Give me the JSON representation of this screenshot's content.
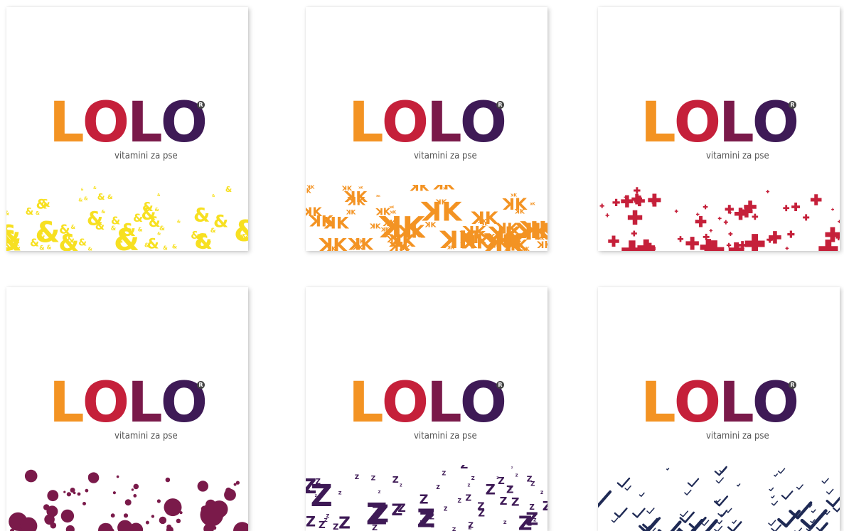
{
  "brand": {
    "letters": [
      "L",
      "O",
      "L",
      "O"
    ],
    "letter_colors": [
      "#f39323",
      "#c5203a",
      "#7a1a4a",
      "#3e1a56"
    ],
    "registered_mark": "®",
    "tagline": "vitamini za pse"
  },
  "cards": [
    {
      "pattern": "ampersand",
      "pattern_color": "#f7e021"
    },
    {
      "pattern": "k-letters",
      "pattern_color": "#f39323"
    },
    {
      "pattern": "plus",
      "pattern_color": "#c5203a"
    },
    {
      "pattern": "dots",
      "pattern_color": "#7a1a4a"
    },
    {
      "pattern": "z-letters",
      "pattern_color": "#3e1a56"
    },
    {
      "pattern": "checkmarks",
      "pattern_color": "#1f2a55"
    }
  ]
}
